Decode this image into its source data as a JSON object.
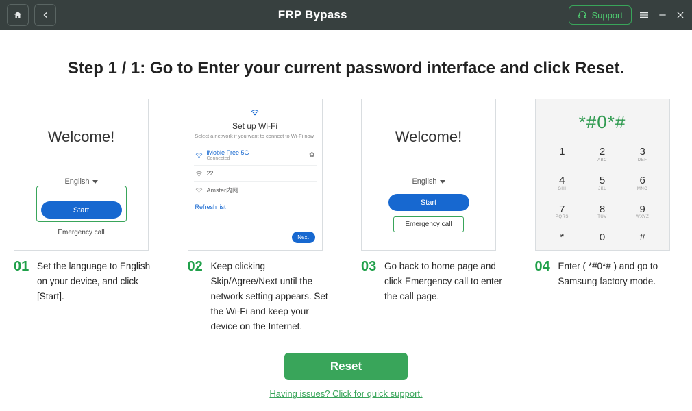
{
  "titlebar": {
    "title": "FRP Bypass",
    "support_label": "Support"
  },
  "header": {
    "step_title": "Step 1 / 1: Go to Enter your current password interface and click Reset."
  },
  "steps": [
    {
      "num": "01",
      "caption": "Set the language to English on your device, and click [Start].",
      "mock": {
        "welcome": "Welcome!",
        "language": "English",
        "start": "Start",
        "emergency": "Emergency call"
      }
    },
    {
      "num": "02",
      "caption": "Keep clicking Skip/Agree/Next until the network setting appears. Set the Wi-Fi and keep your device on the Internet.",
      "mock": {
        "title": "Set up Wi-Fi",
        "subtitle": "Select a network if you want to connect to Wi-Fi now.",
        "net1_name": "iMobie Free 5G",
        "net1_sub": "Connected",
        "net2_name": "22",
        "net3_name": "Amster内网",
        "refresh": "Refresh list",
        "next": "Next"
      }
    },
    {
      "num": "03",
      "caption": "Go back to home page and click Emergency call to enter the call page.",
      "mock": {
        "welcome": "Welcome!",
        "language": "English",
        "start": "Start",
        "emergency": "Emergency call"
      }
    },
    {
      "num": "04",
      "caption": "Enter ( *#0*# ) and go to Samsung factory mode.",
      "mock": {
        "display": "*#0*#",
        "keypad": [
          {
            "k": "1",
            "s": ""
          },
          {
            "k": "2",
            "s": "ABC"
          },
          {
            "k": "3",
            "s": "DEF"
          },
          {
            "k": "4",
            "s": "GHI"
          },
          {
            "k": "5",
            "s": "JKL"
          },
          {
            "k": "6",
            "s": "MNO"
          },
          {
            "k": "7",
            "s": "PQRS"
          },
          {
            "k": "8",
            "s": "TUV"
          },
          {
            "k": "9",
            "s": "WXYZ"
          },
          {
            "k": "*",
            "s": ""
          },
          {
            "k": "0",
            "s": "+"
          },
          {
            "k": "#",
            "s": ""
          }
        ]
      }
    }
  ],
  "footer": {
    "reset_label": "Reset",
    "support_link": "Having issues? Click for quick support."
  }
}
